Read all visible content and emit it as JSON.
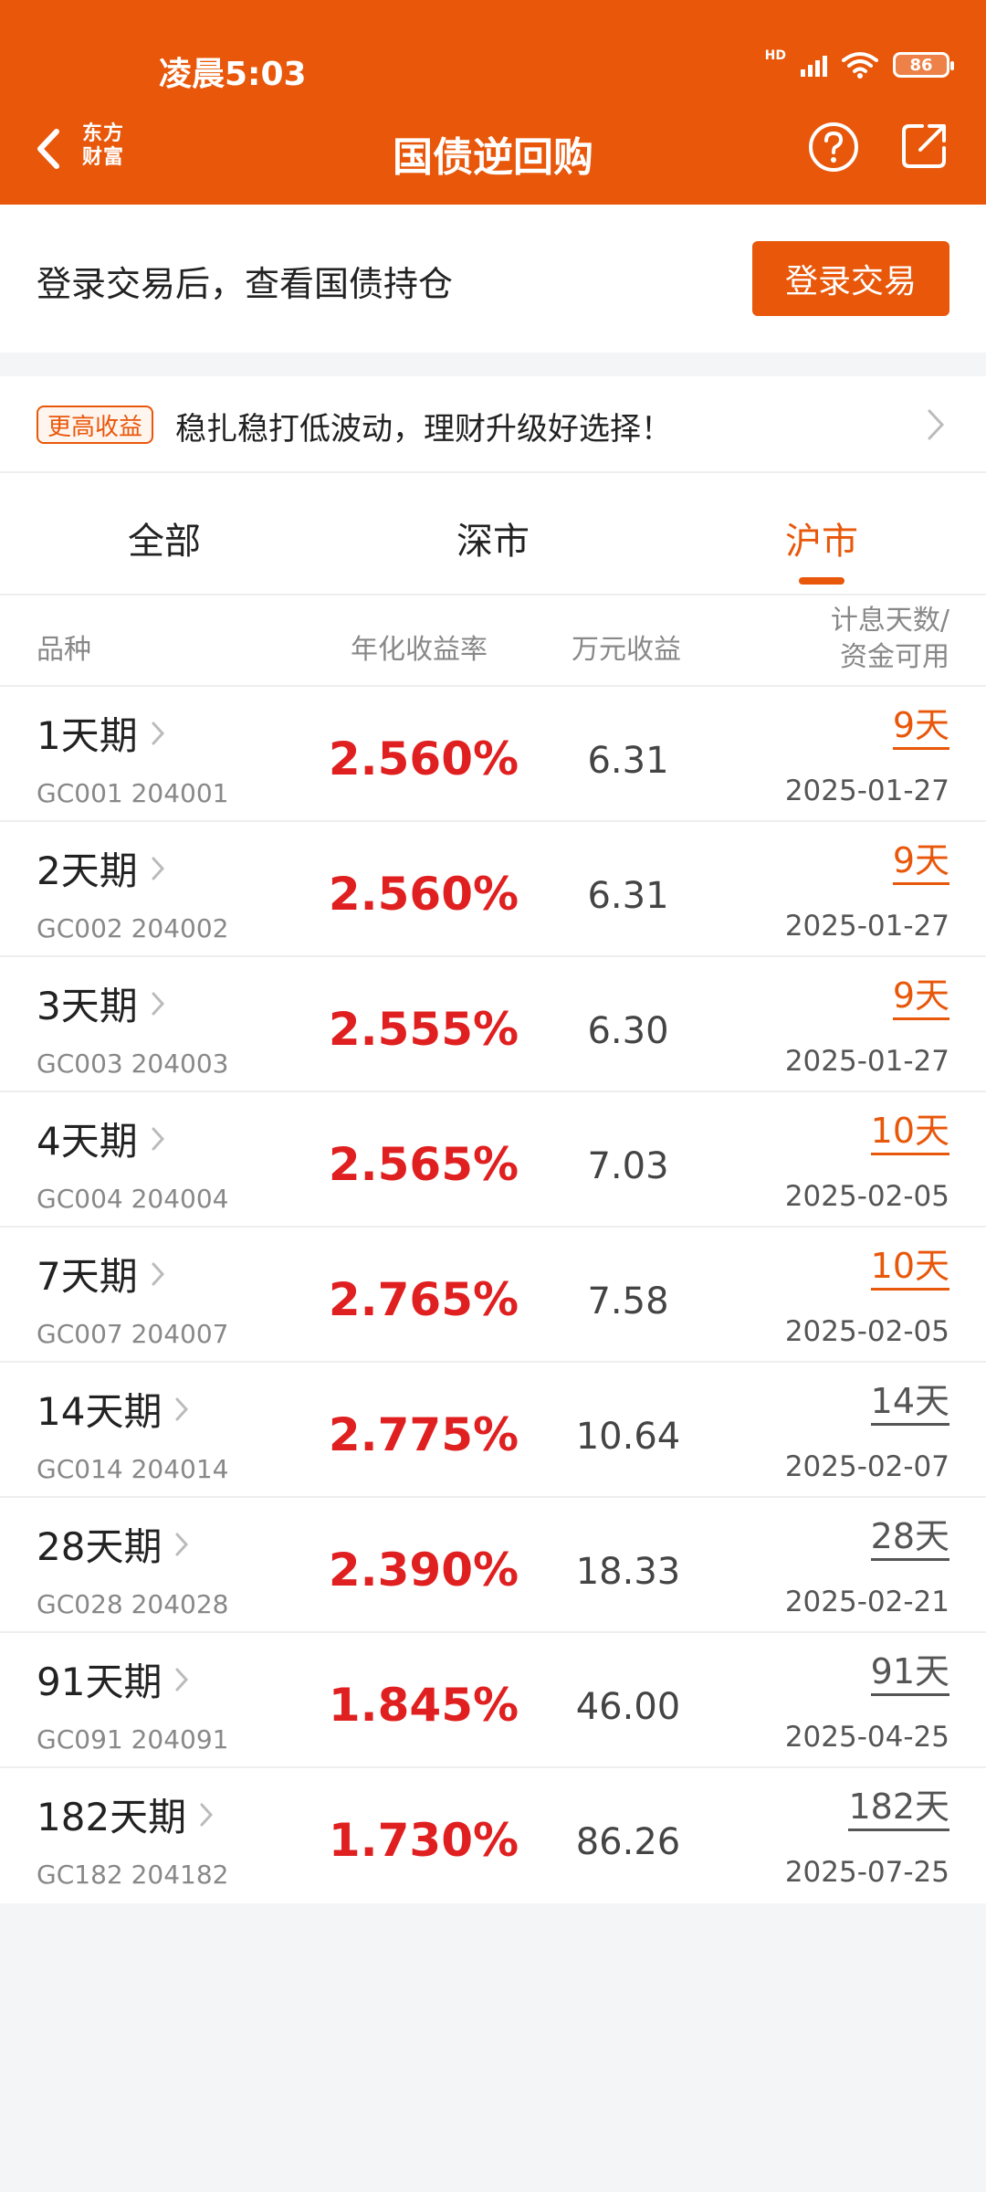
{
  "status": {
    "time": "凌晨5:03",
    "battery": "86",
    "net": "HD"
  },
  "nav": {
    "logo_line1": "东方",
    "logo_line2": "财富",
    "title": "国债逆回购"
  },
  "login": {
    "prompt": "登录交易后，查看国债持仓",
    "button": "登录交易"
  },
  "promo": {
    "badge": "更高收益",
    "text": "稳扎稳打低波动，理财升级好选择！"
  },
  "tabs": [
    {
      "label": "全部",
      "active": false
    },
    {
      "label": "深市",
      "active": false
    },
    {
      "label": "沪市",
      "active": true
    }
  ],
  "columns": {
    "variety": "品种",
    "rate": "年化收益率",
    "income": "万元收益",
    "days_line1": "计息天数/",
    "days_line2": "资金可用"
  },
  "colors": {
    "accent": "#e8570a",
    "rate": "#e02020",
    "days_dark": "#555555"
  },
  "rows": [
    {
      "name": "1天期",
      "code": "GC001 204001",
      "rate": "2.560%",
      "income": "6.31",
      "days": "9天",
      "date": "2025-01-27",
      "highlight": true
    },
    {
      "name": "2天期",
      "code": "GC002 204002",
      "rate": "2.560%",
      "income": "6.31",
      "days": "9天",
      "date": "2025-01-27",
      "highlight": true
    },
    {
      "name": "3天期",
      "code": "GC003 204003",
      "rate": "2.555%",
      "income": "6.30",
      "days": "9天",
      "date": "2025-01-27",
      "highlight": true
    },
    {
      "name": "4天期",
      "code": "GC004 204004",
      "rate": "2.565%",
      "income": "7.03",
      "days": "10天",
      "date": "2025-02-05",
      "highlight": true
    },
    {
      "name": "7天期",
      "code": "GC007 204007",
      "rate": "2.765%",
      "income": "7.58",
      "days": "10天",
      "date": "2025-02-05",
      "highlight": true
    },
    {
      "name": "14天期",
      "code": "GC014 204014",
      "rate": "2.775%",
      "income": "10.64",
      "days": "14天",
      "date": "2025-02-07",
      "highlight": false
    },
    {
      "name": "28天期",
      "code": "GC028 204028",
      "rate": "2.390%",
      "income": "18.33",
      "days": "28天",
      "date": "2025-02-21",
      "highlight": false
    },
    {
      "name": "91天期",
      "code": "GC091 204091",
      "rate": "1.845%",
      "income": "46.00",
      "days": "91天",
      "date": "2025-04-25",
      "highlight": false
    },
    {
      "name": "182天期",
      "code": "GC182 204182",
      "rate": "1.730%",
      "income": "86.26",
      "days": "182天",
      "date": "2025-07-25",
      "highlight": false
    }
  ]
}
